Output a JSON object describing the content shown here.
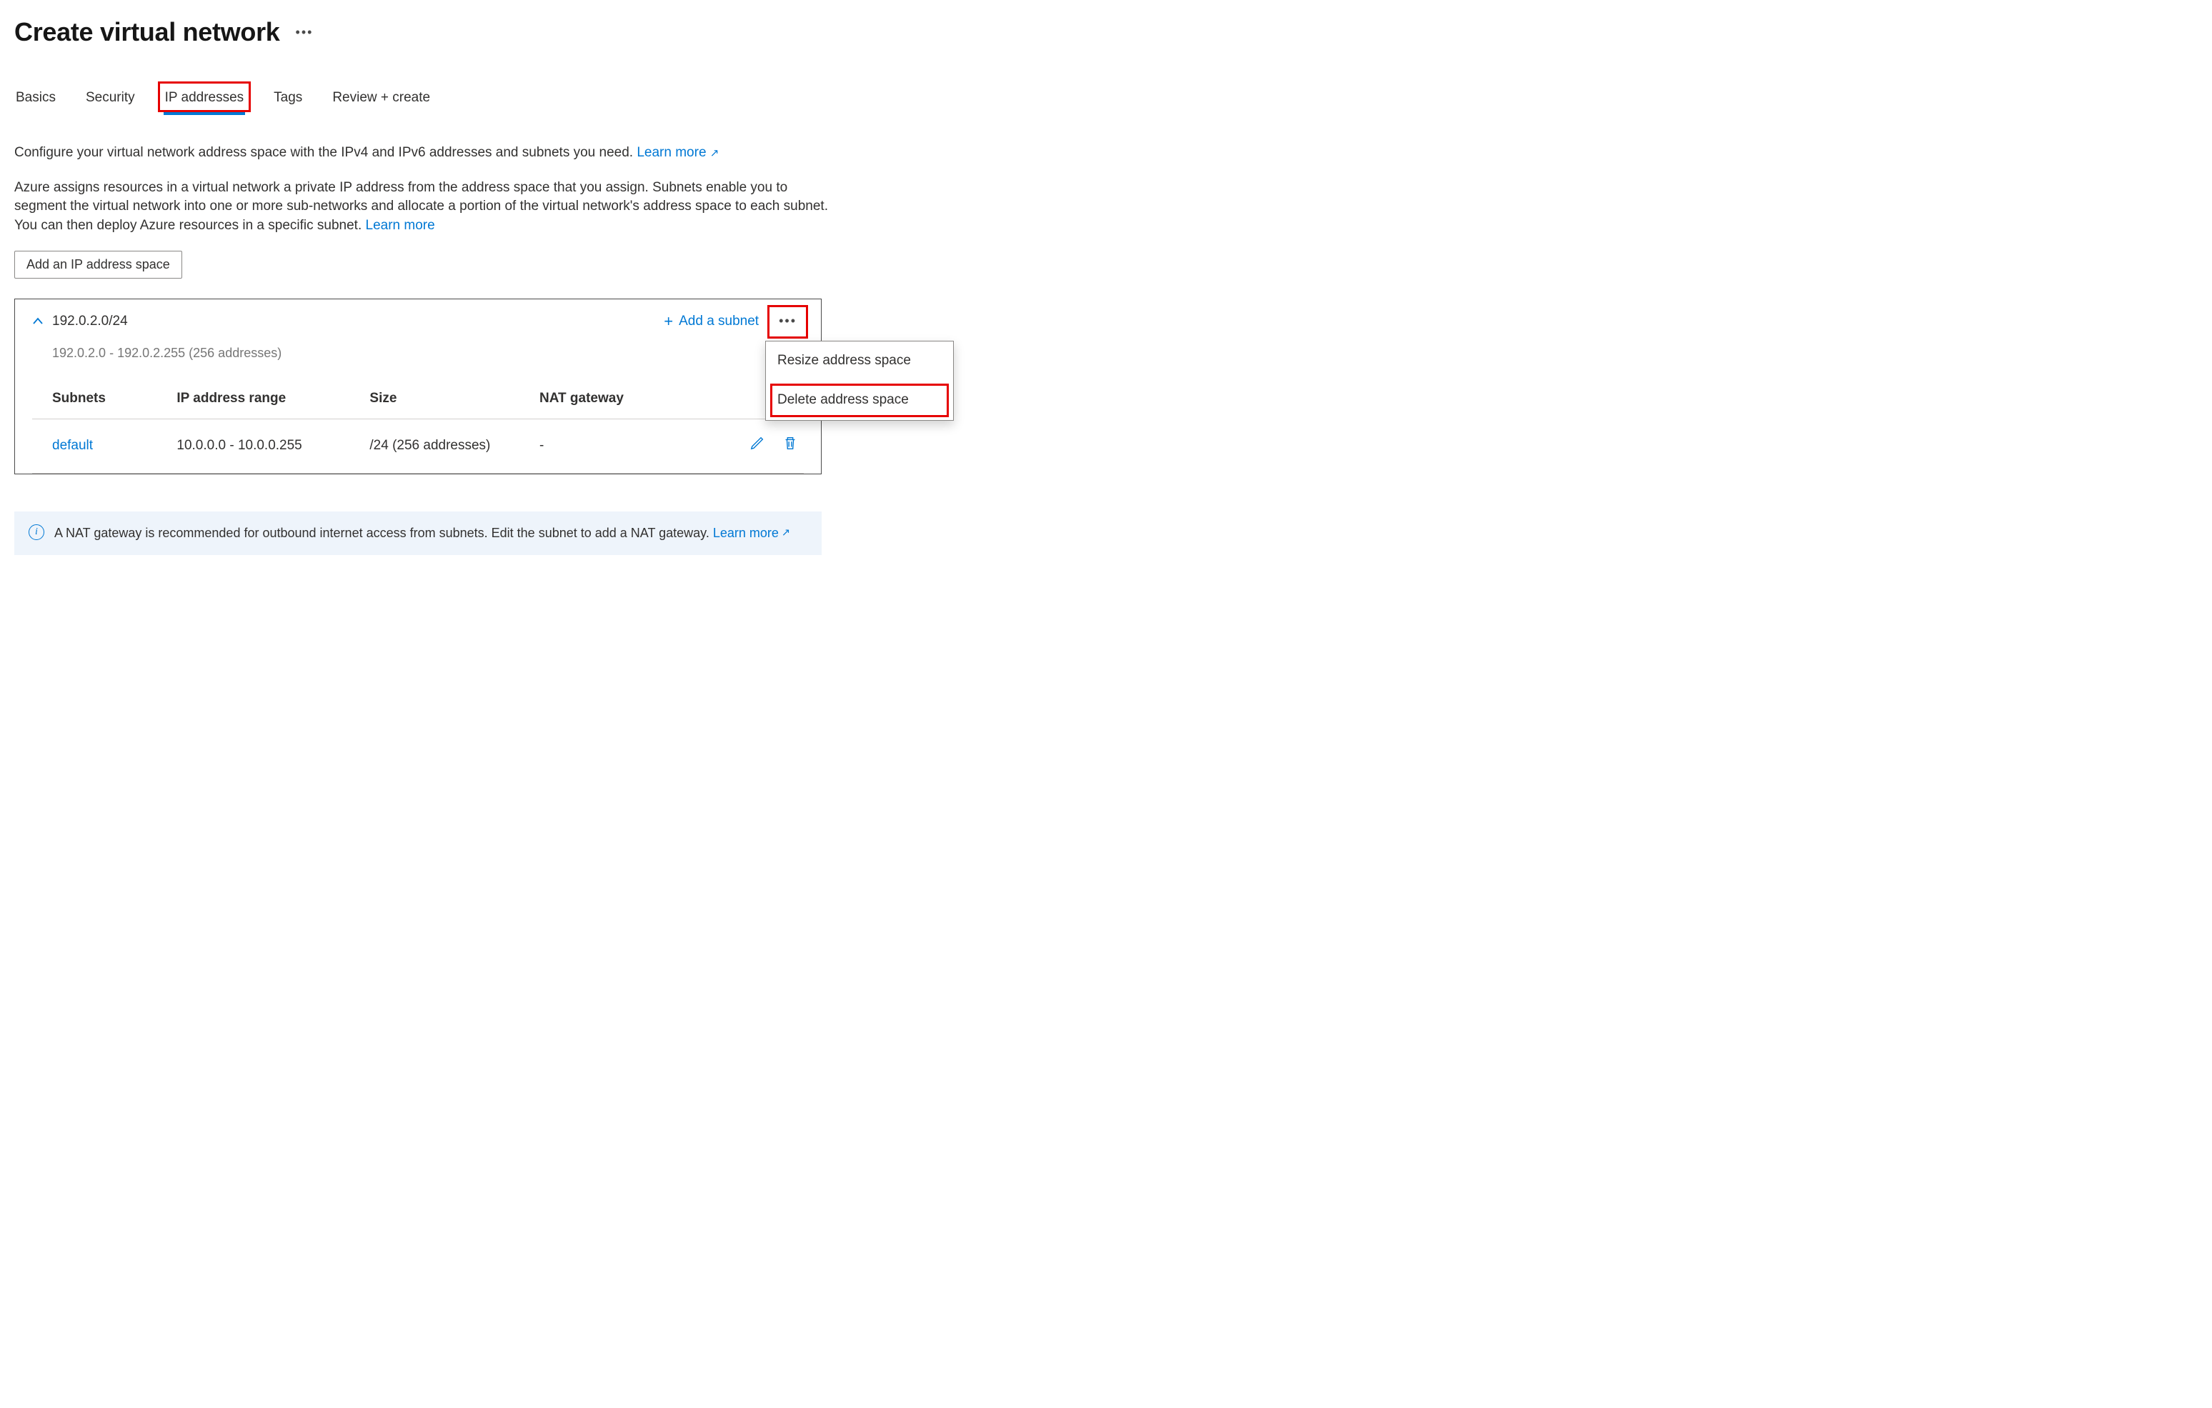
{
  "page": {
    "title": "Create virtual network"
  },
  "tabs": [
    {
      "label": "Basics",
      "selected": false
    },
    {
      "label": "Security",
      "selected": false
    },
    {
      "label": "IP addresses",
      "selected": true,
      "highlighted": true
    },
    {
      "label": "Tags",
      "selected": false
    },
    {
      "label": "Review + create",
      "selected": false
    }
  ],
  "description": {
    "line1": "Configure your virtual network address space with the IPv4 and IPv6 addresses and subnets you need.",
    "learn_more_1": "Learn more",
    "line2": "Azure assigns resources in a virtual network a private IP address from the address space that you assign. Subnets enable you to segment the virtual network into one or more sub-networks and allocate a portion of the virtual network's address space to each subnet. You can then deploy Azure resources in a specific subnet.",
    "learn_more_2": "Learn more"
  },
  "buttons": {
    "add_address_space": "Add an IP address space",
    "add_subnet": "Add a subnet"
  },
  "address_space": {
    "cidr": "192.0.2.0/24",
    "range_note": "192.0.2.0 - 192.0.2.255 (256 addresses)",
    "columns": {
      "subnets": "Subnets",
      "ip_range": "IP address range",
      "size": "Size",
      "nat_gateway": "NAT gateway"
    },
    "rows": [
      {
        "name": "default",
        "ip_range": "10.0.0.0 - 10.0.0.255",
        "size": "/24 (256 addresses)",
        "nat_gateway": "-"
      }
    ],
    "context_menu": {
      "resize": "Resize address space",
      "delete": "Delete address space",
      "delete_highlighted": true
    }
  },
  "info_banner": {
    "text": "A NAT gateway is recommended for outbound internet access from subnets. Edit the subnet to add a NAT gateway.",
    "learn_more": "Learn more"
  }
}
